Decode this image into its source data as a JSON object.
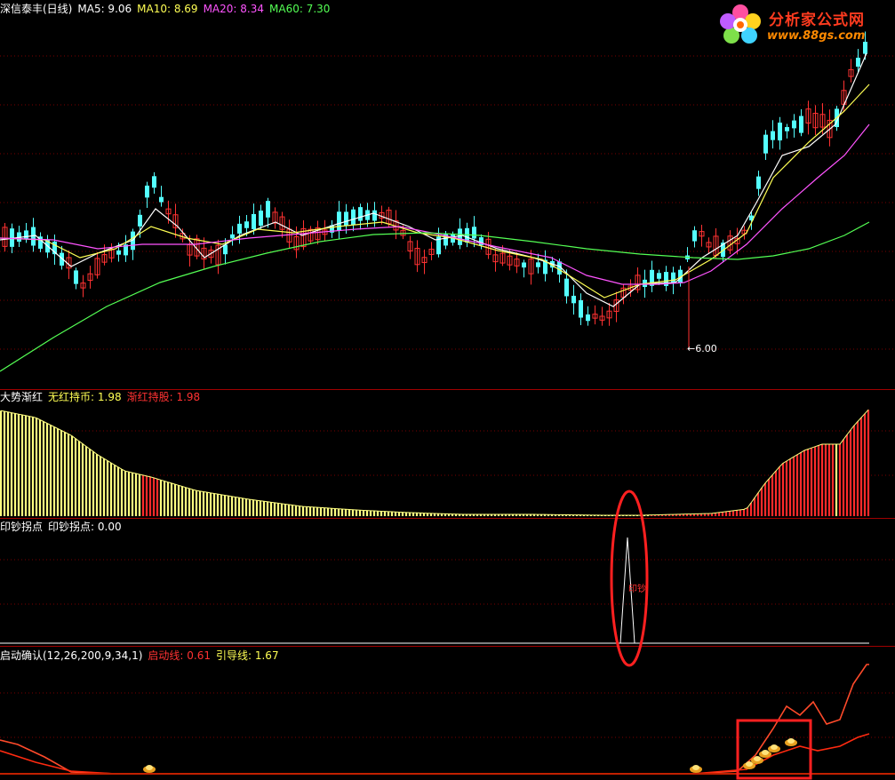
{
  "main_panel": {
    "title": "深信泰丰(日线)",
    "ma5_label": "MA5: 9.06",
    "ma10_label": "MA10: 8.69",
    "ma20_label": "MA20: 8.34",
    "ma60_label": "MA60: 7.30",
    "low_marker": "←6.00"
  },
  "panel2": {
    "name": "大势渐红",
    "line1_label": "无红持币: 1.98",
    "line2_label": "渐红持股: 1.98"
  },
  "panel3": {
    "name": "印钞拐点",
    "value_label": "印钞拐点: 0.00",
    "peak_text": "印钞"
  },
  "panel4": {
    "name": "启动确认(12,26,200,9,34,1)",
    "line1_label": "启动线: 0.61",
    "line2_label": "引导线: 1.67"
  },
  "logo": {
    "title": "分析家公式网",
    "url": "www.88gs.com"
  },
  "colors": {
    "background": "#000000",
    "up": "#ff3232",
    "down": "#54ffff",
    "ma5": "#ffffff",
    "ma10": "#ffff54",
    "ma20": "#ff54ff",
    "ma60": "#54ff54",
    "hist_yellow": "#ffff80",
    "hist_red": "#ff2a2a",
    "panel_border": "#a00000",
    "highlight": "#ff2020"
  }
}
